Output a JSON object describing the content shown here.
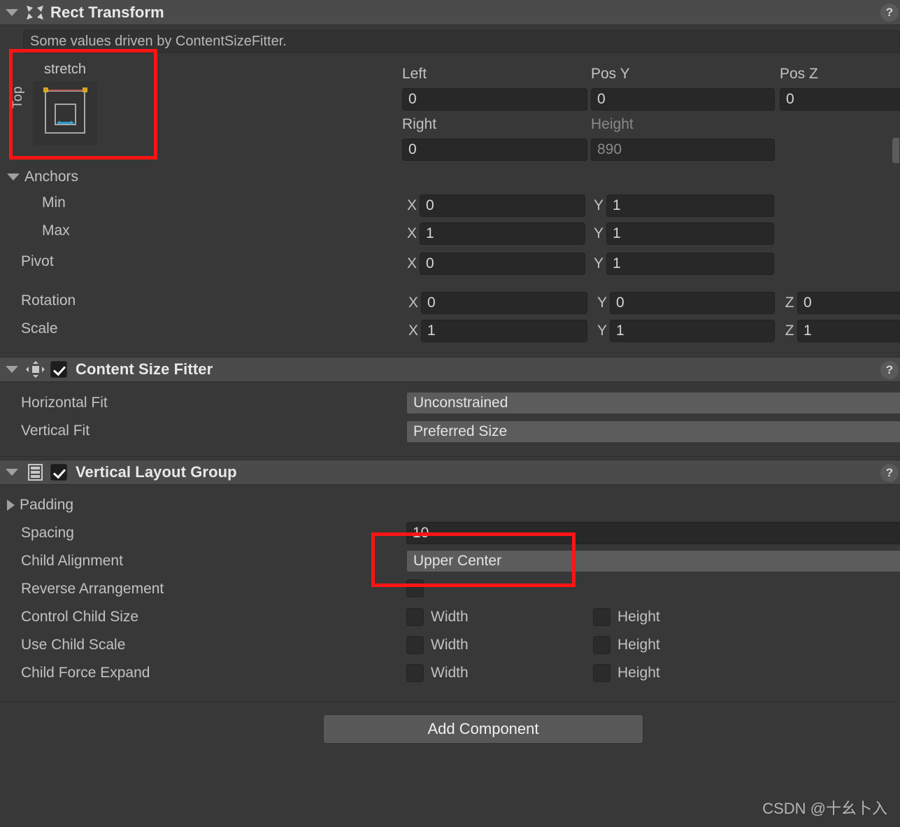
{
  "rect_transform": {
    "title": "Rect Transform",
    "icon": "rect-transform-icon",
    "help_label": "?",
    "info_message": "Some values driven by ContentSizeFitter.",
    "anchor_preset": {
      "label": "stretch",
      "vertical_label": "Top"
    },
    "fields": {
      "left_label": "Left",
      "left_value": "0",
      "pos_y_label": "Pos Y",
      "pos_y_value": "0",
      "pos_z_label": "Pos Z",
      "pos_z_value": "0",
      "right_label": "Right",
      "right_value": "0",
      "height_label": "Height",
      "height_value": "890"
    },
    "anchors": {
      "section_label": "Anchors",
      "min_label": "Min",
      "min_x_axis": "X",
      "min_x": "0",
      "min_y_axis": "Y",
      "min_y": "1",
      "max_label": "Max",
      "max_x_axis": "X",
      "max_x": "1",
      "max_y_axis": "Y",
      "max_y": "1"
    },
    "pivot": {
      "label": "Pivot",
      "x_axis": "X",
      "x": "0",
      "y_axis": "Y",
      "y": "1"
    },
    "rotation": {
      "label": "Rotation",
      "x_axis": "X",
      "x": "0",
      "y_axis": "Y",
      "y": "0",
      "z_axis": "Z",
      "z": "0"
    },
    "scale": {
      "label": "Scale",
      "x_axis": "X",
      "x": "1",
      "y_axis": "Y",
      "y": "1",
      "z_axis": "Z",
      "z": "1"
    }
  },
  "content_size_fitter": {
    "title": "Content Size Fitter",
    "icon": "content-size-fitter-icon",
    "enabled": true,
    "help_label": "?",
    "horizontal_fit_label": "Horizontal Fit",
    "horizontal_fit_value": "Unconstrained",
    "vertical_fit_label": "Vertical Fit",
    "vertical_fit_value": "Preferred Size"
  },
  "vertical_layout_group": {
    "title": "Vertical Layout Group",
    "icon": "vertical-layout-group-icon",
    "enabled": true,
    "help_label": "?",
    "padding_label": "Padding",
    "spacing_label": "Spacing",
    "spacing_value": "10",
    "child_alignment_label": "Child Alignment",
    "child_alignment_value": "Upper Center",
    "reverse_arrangement_label": "Reverse Arrangement",
    "reverse_arrangement_checked": false,
    "control_child_size_label": "Control Child Size",
    "control_child_size_width_label": "Width",
    "control_child_size_height_label": "Height",
    "use_child_scale_label": "Use Child Scale",
    "use_child_scale_width_label": "Width",
    "use_child_scale_height_label": "Height",
    "child_force_expand_label": "Child Force Expand",
    "child_force_expand_width_label": "Width",
    "child_force_expand_height_label": "Height"
  },
  "footer": {
    "add_component_label": "Add Component",
    "watermark": "CSDN @十幺卜入"
  },
  "colors": {
    "panel_bg": "#383838",
    "header_bg": "#4b4b4b",
    "field_bg": "#282828",
    "dropdown_bg": "#5c5c5c",
    "annotation_red": "#ff1414",
    "anchor_handle": "#d8a520",
    "anchor_line": "#b2564f",
    "anchor_arrow": "#29a8df"
  }
}
